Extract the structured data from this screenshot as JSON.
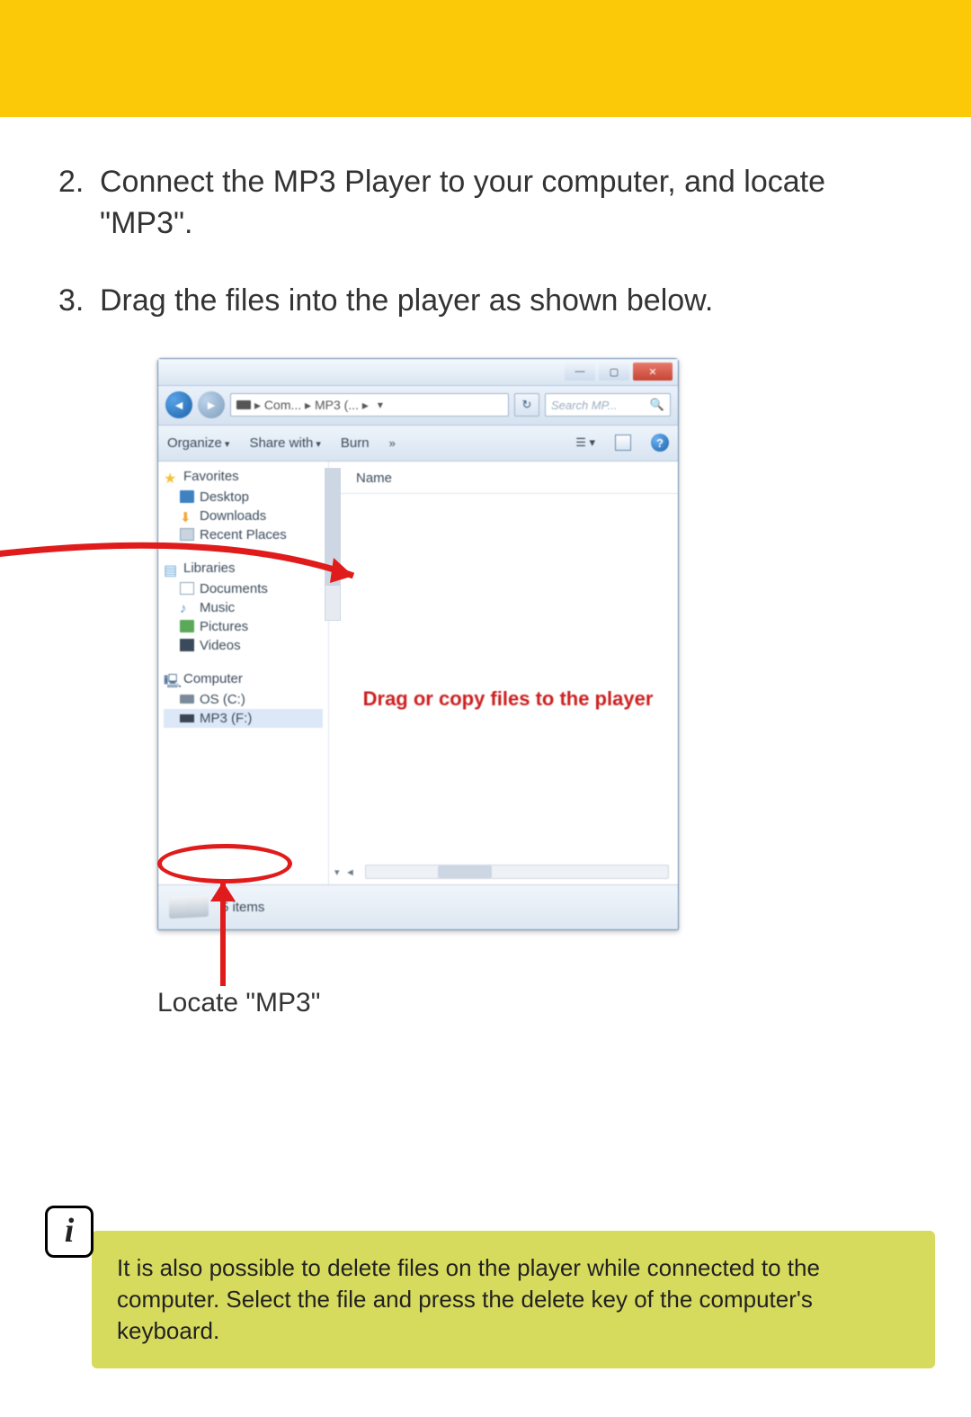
{
  "steps": {
    "s2_num": "2.",
    "s2_text": "Connect the MP3 Player to your computer, and locate \"MP3\".",
    "s3_num": "3.",
    "s3_text": "Drag the files into the player as shown below."
  },
  "explorer": {
    "address": "▸ Com... ▸ MP3 (... ▸",
    "search_placeholder": "Search MP...",
    "toolbar": {
      "organize": "Organize",
      "share": "Share with",
      "burn": "Burn"
    },
    "column_header": "Name",
    "nav": {
      "favorites": "Favorites",
      "desktop": "Desktop",
      "downloads": "Downloads",
      "recent": "Recent Places",
      "libraries": "Libraries",
      "documents": "Documents",
      "music": "Music",
      "pictures": "Pictures",
      "videos": "Videos",
      "computer": "Computer",
      "osc": "OS (C:)",
      "mp3f": "MP3 (F:)"
    },
    "status": "5 items"
  },
  "annotations": {
    "drag_text": "Drag or copy files to the player",
    "caption": "Locate \"MP3\""
  },
  "info": {
    "icon": "i",
    "text": "It is also possible to delete files on the player while connected to the computer. Select the file and press the delete key of the computer's keyboard."
  }
}
